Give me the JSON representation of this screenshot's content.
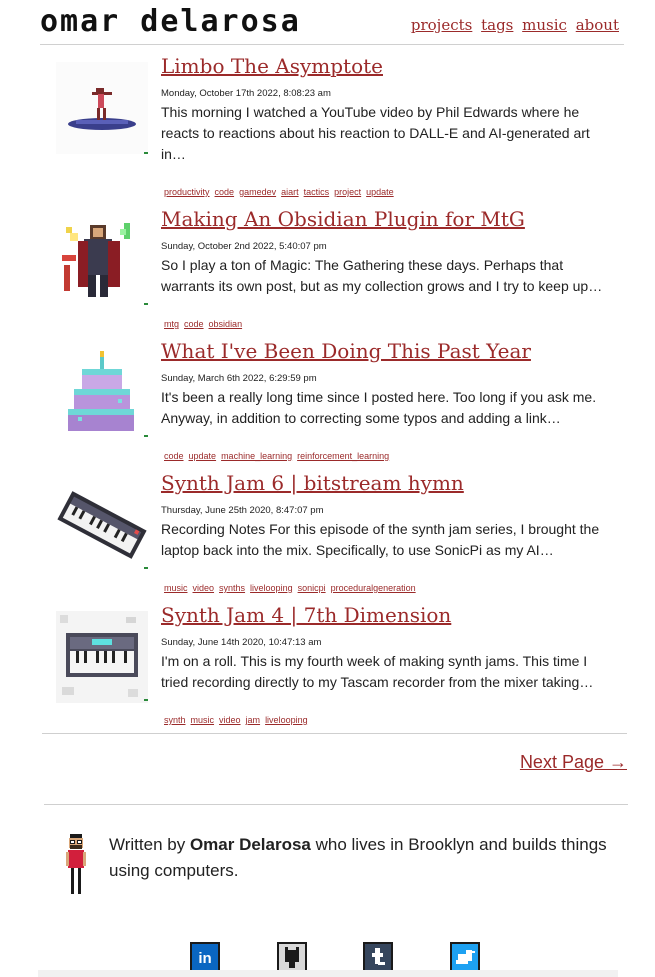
{
  "site": {
    "logo": "omar delarosa",
    "nav": [
      "projects",
      "tags",
      "music",
      "about"
    ]
  },
  "posts": [
    {
      "title": "Limbo The Asymptote",
      "date": "Monday, October 17th 2022, 8:08:23 am",
      "excerpt": "This morning I watched a YouTube video by Phil Edwards where he reacts to reactions about his reaction to DALL-E and AI-generated art in…",
      "tags": [
        "productivity",
        "code",
        "gamedev",
        "aiart",
        "tactics",
        "project",
        "update"
      ],
      "thumb_icon": "dancer-on-platform-icon"
    },
    {
      "title": "Making An Obsidian Plugin for MtG",
      "date": "Sunday, October 2nd 2022, 5:40:07 pm",
      "excerpt": "So I play a ton of Magic: The Gathering these days. Perhaps that warrants its own post, but as my collection grows and I try to keep up…",
      "tags": [
        "mtg",
        "code",
        "obsidian"
      ],
      "thumb_icon": "planeswalker-icon"
    },
    {
      "title": "What I've Been Doing This Past Year",
      "date": "Sunday, March 6th 2022, 6:29:59 pm",
      "excerpt": "It's been a really long time since I posted here. Too long if you ask me. Anyway, in addition to correcting some typos and adding a link…",
      "tags": [
        "code",
        "update",
        "machine_learning",
        "reinforcement_learning"
      ],
      "thumb_icon": "birthday-cake-icon"
    },
    {
      "title": "Synth Jam 6 | bitstream hymn",
      "date": "Thursday, June 25th 2020, 8:47:07 pm",
      "excerpt": "Recording Notes For this episode of the synth jam series, I brought the laptop back into the mix. Specifically, to use SonicPi as my AI…",
      "tags": [
        "music",
        "video",
        "synths",
        "livelooping",
        "sonicpi",
        "proceduralgeneration"
      ],
      "thumb_icon": "keyboard-synth-icon"
    },
    {
      "title": "Synth Jam 4 | 7th Dimension",
      "date": "Sunday, June 14th 2020, 10:47:13 am",
      "excerpt": "I'm on a roll. This is my fourth week of making synth jams. This time I tried recording directly to my Tascam recorder from the mixer taking…",
      "tags": [
        "synth",
        "music",
        "video",
        "jam",
        "livelooping"
      ],
      "thumb_icon": "synth-mixer-icon"
    }
  ],
  "pagination": {
    "next": "Next Page →"
  },
  "bio": {
    "prefix": "Written by ",
    "name": "Omar Delarosa",
    "suffix": " who lives in Brooklyn and builds things using computers."
  },
  "socials": [
    {
      "name": "linkedin-icon",
      "label": "in",
      "color": "#0a66c2"
    },
    {
      "name": "github-icon",
      "label": "",
      "color": "#444444"
    },
    {
      "name": "tumblr-icon",
      "label": "t",
      "color": "#36465d"
    },
    {
      "name": "twitter-icon",
      "label": "",
      "color": "#1da1f2"
    }
  ],
  "colors": {
    "link": "#9b2a2a",
    "divider": "#cfcfcf"
  }
}
